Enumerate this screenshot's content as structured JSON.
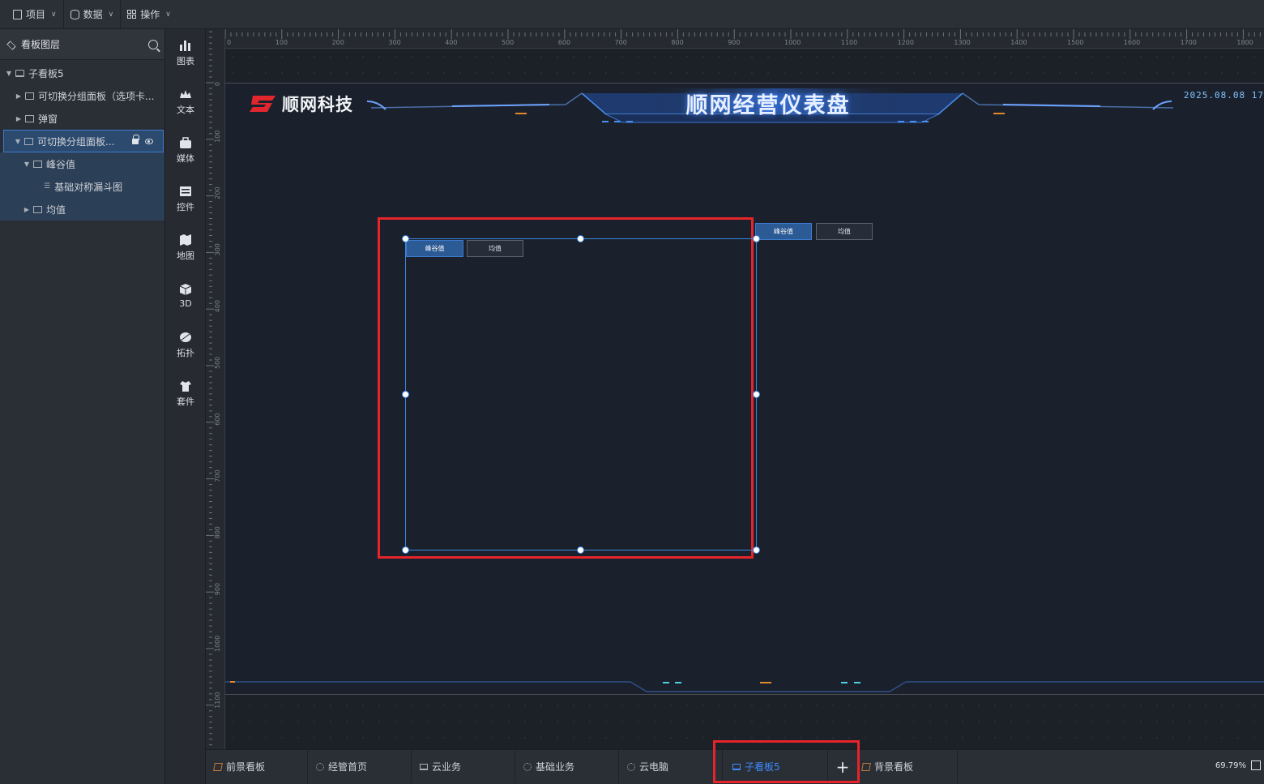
{
  "topbar": {
    "menus": [
      {
        "label": "项目"
      },
      {
        "label": "数据"
      },
      {
        "label": "操作"
      }
    ]
  },
  "layers": {
    "title": "看板图层",
    "tree": [
      {
        "label": "子看板5",
        "level": 0,
        "expanded": true
      },
      {
        "label": "可切换分组面板（选项卡...",
        "level": 1,
        "expanded": false
      },
      {
        "label": "弹窗",
        "level": 1,
        "expanded": false
      },
      {
        "label": "可切换分组面板...",
        "level": 1,
        "expanded": true,
        "selected": true
      },
      {
        "label": "峰谷值",
        "level": 2,
        "expanded": true
      },
      {
        "label": "基础对称漏斗图",
        "level": 3
      },
      {
        "label": "均值",
        "level": 2,
        "expanded": false
      }
    ]
  },
  "components": [
    {
      "label": "图表",
      "icon": "bar-chart-icon"
    },
    {
      "label": "文本",
      "icon": "text-icon"
    },
    {
      "label": "媒体",
      "icon": "media-icon"
    },
    {
      "label": "控件",
      "icon": "control-icon"
    },
    {
      "label": "地图",
      "icon": "map-icon"
    },
    {
      "label": "3D",
      "icon": "cube-icon"
    },
    {
      "label": "拓扑",
      "icon": "topology-icon"
    },
    {
      "label": "套件",
      "icon": "suite-icon"
    }
  ],
  "rulers": {
    "h_labels": [
      "0",
      "100",
      "200",
      "300",
      "400",
      "500",
      "600",
      "700",
      "800",
      "900",
      "1000",
      "1100",
      "1200",
      "1300",
      "1400",
      "1500",
      "1600",
      "1700",
      "1800"
    ],
    "v_labels": [
      "0",
      "100",
      "200",
      "300",
      "400",
      "500",
      "600",
      "700",
      "800",
      "900",
      "1000",
      "1100"
    ]
  },
  "dashboard": {
    "logo_text": "顺网科技",
    "title": "顺网经营仪表盘",
    "date": "2025.08.08 17",
    "selected_panel_tabs": [
      "峰谷值",
      "均值"
    ],
    "other_panel_tabs": [
      "峰谷值",
      "均值"
    ]
  },
  "bottom_tabs": [
    {
      "label": "前景看板",
      "icon": "edit-icon"
    },
    {
      "label": "经管首页",
      "icon": "loading-icon"
    },
    {
      "label": "云业务",
      "icon": "screen-icon"
    },
    {
      "label": "基础业务",
      "icon": "loading-icon"
    },
    {
      "label": "云电脑",
      "icon": "loading-icon"
    },
    {
      "label": "子看板5",
      "icon": "screen-icon",
      "active": true
    },
    {
      "label": "背景看板",
      "icon": "edit-icon"
    }
  ],
  "add_tab": "+",
  "zoom": "69.79%",
  "colors": {
    "accent": "#3c8cff",
    "highlight_red": "#e5242b",
    "selected_bg": "#2c4a6e"
  }
}
